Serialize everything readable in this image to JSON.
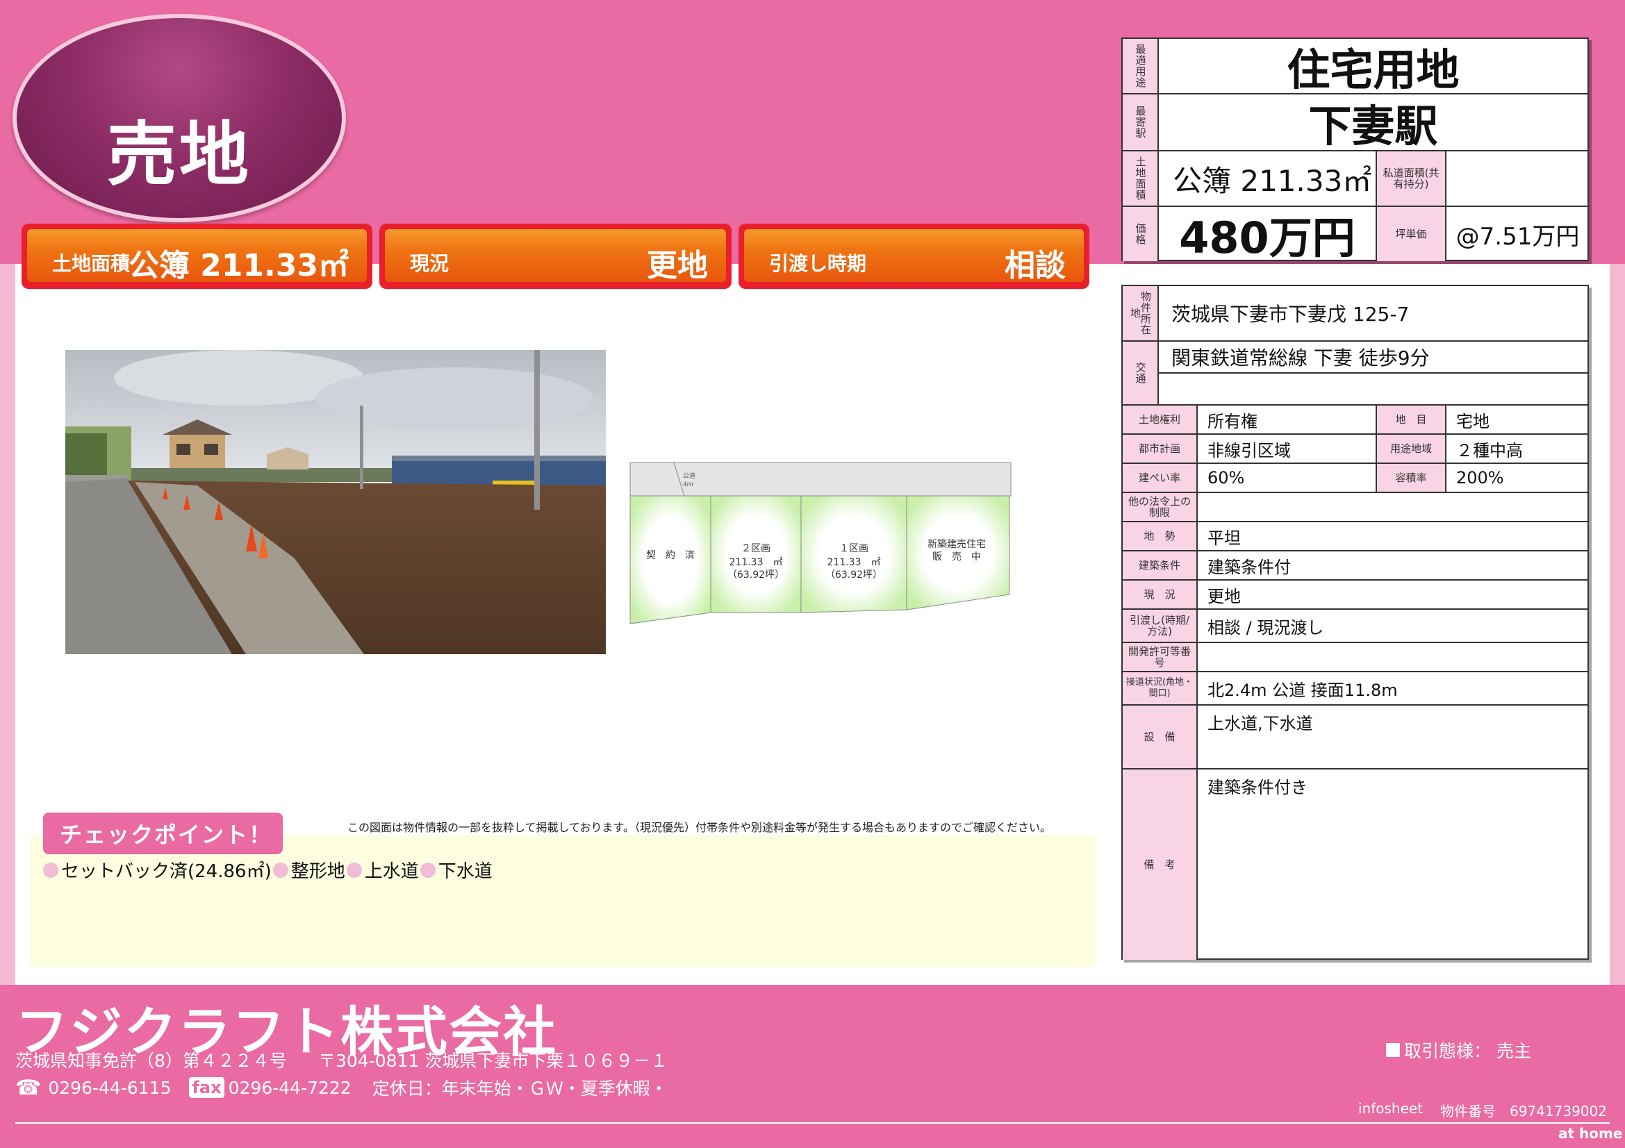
{
  "badge": {
    "text": "売地"
  },
  "summary": [
    {
      "label": "土地面積",
      "value": "公簿 211.33㎡"
    },
    {
      "label": "現況",
      "value": "更地"
    },
    {
      "label": "引渡し時期",
      "value": "相談"
    }
  ],
  "top_table": {
    "use_label": "最適用途",
    "use_value": "住宅用地",
    "station_label": "最寄駅",
    "station_value": "下妻駅",
    "area_label": "土地面積",
    "area_value": "公簿 211.33㎡",
    "private_road_label": "私道面積(共有持分)",
    "private_road_value": "",
    "price_label": "価格",
    "price_value": "480万円",
    "tsubo_label": "坪単価",
    "tsubo_value": "@7.51万円"
  },
  "detail_table": {
    "location_label": "物件所在地",
    "location_value": "茨城県下妻市下妻戊 125-7",
    "transport_label": "交通",
    "transport_value": "関東鉄道常総線 下妻 徒歩9分",
    "rows": [
      {
        "label": "土地権利",
        "value": "所有権",
        "label2": "地　目",
        "value2": "宅地"
      },
      {
        "label": "都市計画",
        "value": "非線引区域",
        "label2": "用途地域",
        "value2": "２種中高"
      },
      {
        "label": "建ぺい率",
        "value": "60%",
        "label2": "容積率",
        "value2": "200%"
      }
    ],
    "other_law_label": "他の法令上の制限",
    "other_law_value": "",
    "terrain_label": "地　勢",
    "terrain_value": "平坦",
    "build_cond_label": "建築条件",
    "build_cond_value": "建築条件付",
    "status_label": "現　況",
    "status_value": "更地",
    "handover_label": "引渡し(時期/方法)",
    "handover_value": "相談 / 現況渡し",
    "dev_permit_label": "開発許可等番号",
    "dev_permit_value": "",
    "road_label": "接道状況(角地・間口)",
    "road_value": "北2.4m 公道 接面11.8m",
    "facility_label": "設　備",
    "facility_value": "上水道,下水道",
    "remarks_label": "備　考",
    "remarks_value": "建築条件付き"
  },
  "plot_map": {
    "road": "公道\n4ｍ",
    "lots": [
      {
        "name": "契　約　済"
      },
      {
        "name": "２区画",
        "area": "211.33　㎡",
        "tsubo": "（63.92坪）"
      },
      {
        "name": "１区画",
        "area": "211.33　㎡",
        "tsubo": "（63.92坪）"
      },
      {
        "name": "新築建売住宅",
        "sub": "販　売　中"
      }
    ]
  },
  "disclaimer": "この図面は物件情報の一部を抜粋して掲載しております。（現況優先）付帯条件や別途料金等が発生する場合もありますのでご確認ください。",
  "checkpoint": {
    "title": "チェックポイント！",
    "items": [
      "セットバック済(24.86㎡)",
      "整形地",
      "上水道",
      "下水道"
    ]
  },
  "footer": {
    "company": "フジクラフト株式会社",
    "license": "茨城県知事免許（8）第４２２４号",
    "address": "〒304-0811 茨城県下妻市下栗１０６９－１",
    "tel": "0296-44-6115",
    "fax_icon": "fax",
    "fax": "0296-44-7222",
    "holiday": "定休日：年末年始・ＧＷ・夏季休暇・",
    "deal": "取引態様：  売主",
    "infosheet": "infosheet",
    "property_no": "物件番号　69741739002",
    "brand": "at home"
  },
  "colors": {
    "pink": "#ea6aa3",
    "light_pink": "#f8d4e5",
    "orange": "#ef7413",
    "red": "#e9202b",
    "badge": "#8e2d66"
  }
}
